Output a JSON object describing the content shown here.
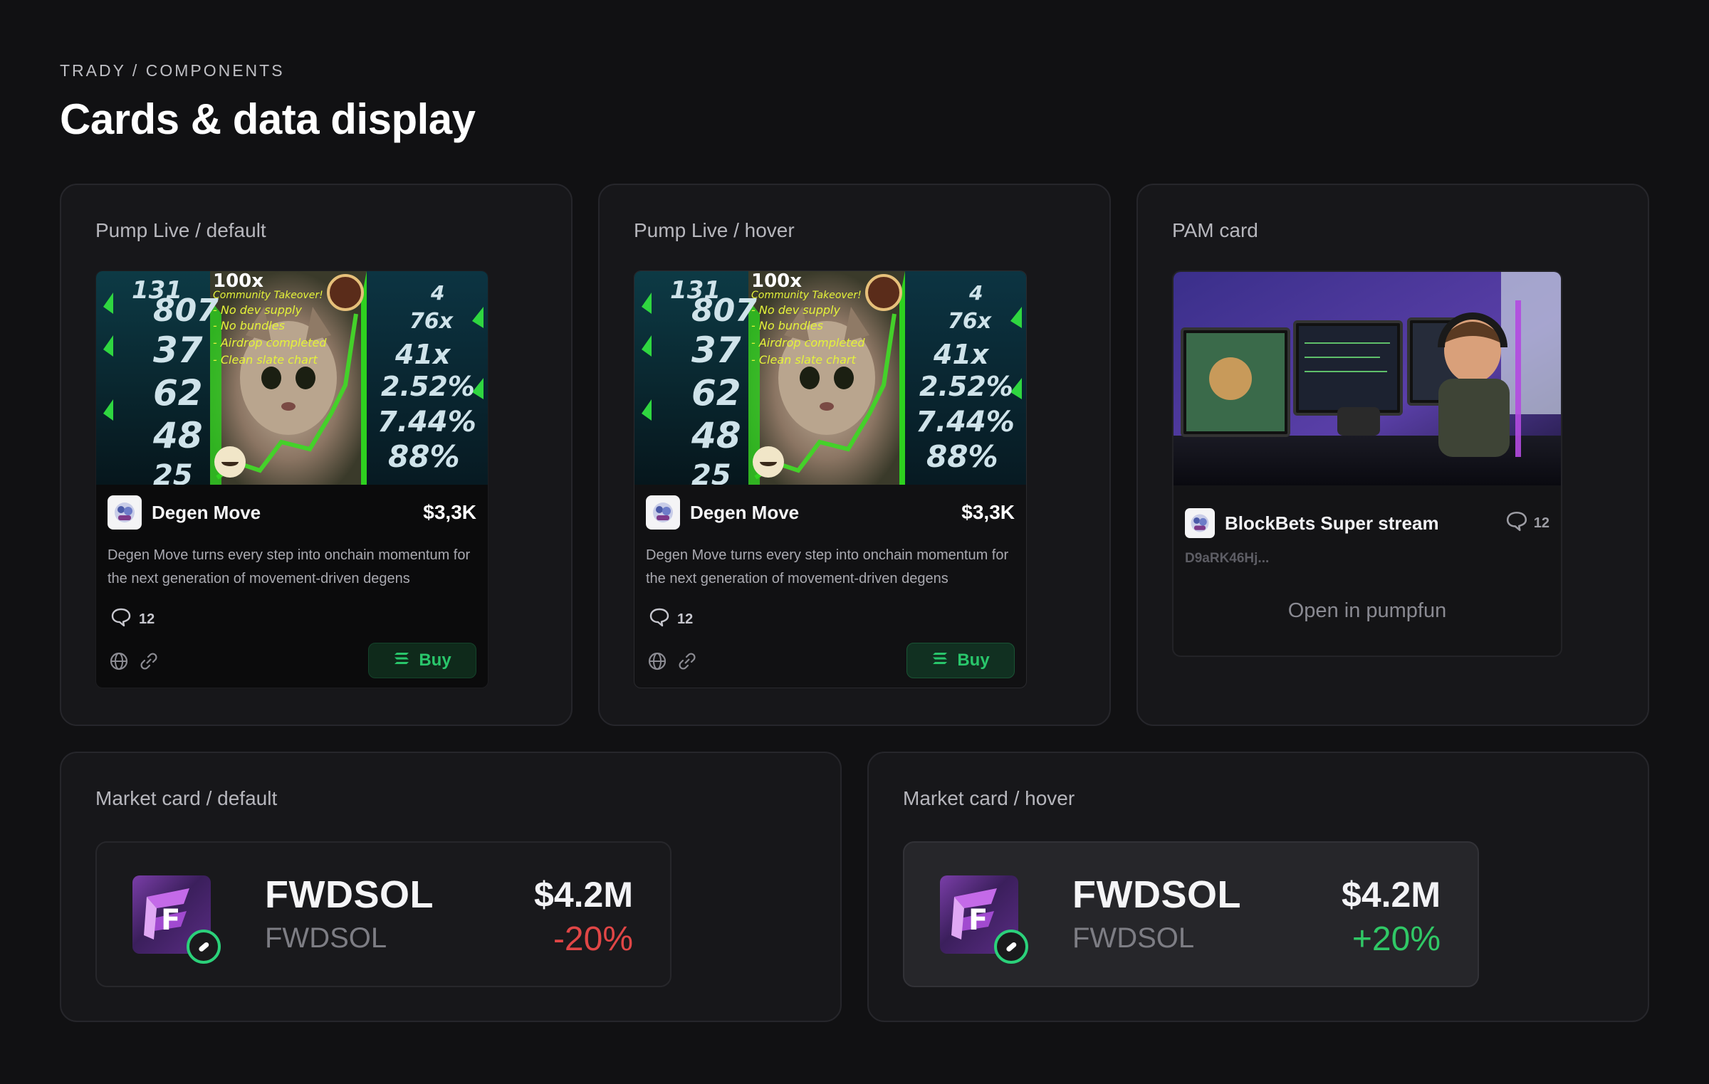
{
  "header": {
    "breadcrumb": "TRADY / COMPONENTS",
    "title": "Cards & data display"
  },
  "panels": {
    "pump_default": {
      "label": "Pump Live / default"
    },
    "pump_hover": {
      "label": "Pump Live / hover"
    },
    "pam": {
      "label": "PAM card"
    },
    "market_default": {
      "label": "Market card / default"
    },
    "market_hover": {
      "label": "Market card / hover"
    }
  },
  "pump_card": {
    "thumb_text": {
      "headline": "100x",
      "lines": [
        "Community Takeover!",
        "- No dev supply",
        "- No bundles",
        "- Airdrop completed",
        "- Clean slate chart"
      ],
      "left_numbers": [
        "131",
        "807",
        "37",
        "62",
        "48",
        "25"
      ],
      "right_numbers": [
        "4",
        "76x",
        "41x",
        "2.52%",
        "7.44%",
        "88%"
      ]
    },
    "name": "Degen Move",
    "price": "$3,3K",
    "description": "Degen Move turns every step into onchain momentum for the next generation of movement-driven degens",
    "comment_count": "12",
    "buy_label": "Buy",
    "icons": {
      "comment": "comment-bubble-icon",
      "globe": "globe-icon",
      "link": "link-icon",
      "buy": "solana-icon"
    }
  },
  "pam_card": {
    "name": "BlockBets Super stream",
    "comment_count": "12",
    "address": "D9aRK46Hj...",
    "open_label": "Open in pumpfun"
  },
  "market_card": {
    "symbol": "FWDSOL",
    "subtitle": "FWDSOL",
    "logo_letter": "F",
    "value": "$4.2M",
    "change_default": "-20%",
    "change_hover": "+20%"
  },
  "colors": {
    "background": "#111113",
    "panel": "#17171a",
    "buy_green": "#29c66b",
    "negative": "#e04646",
    "positive": "#30c866"
  }
}
